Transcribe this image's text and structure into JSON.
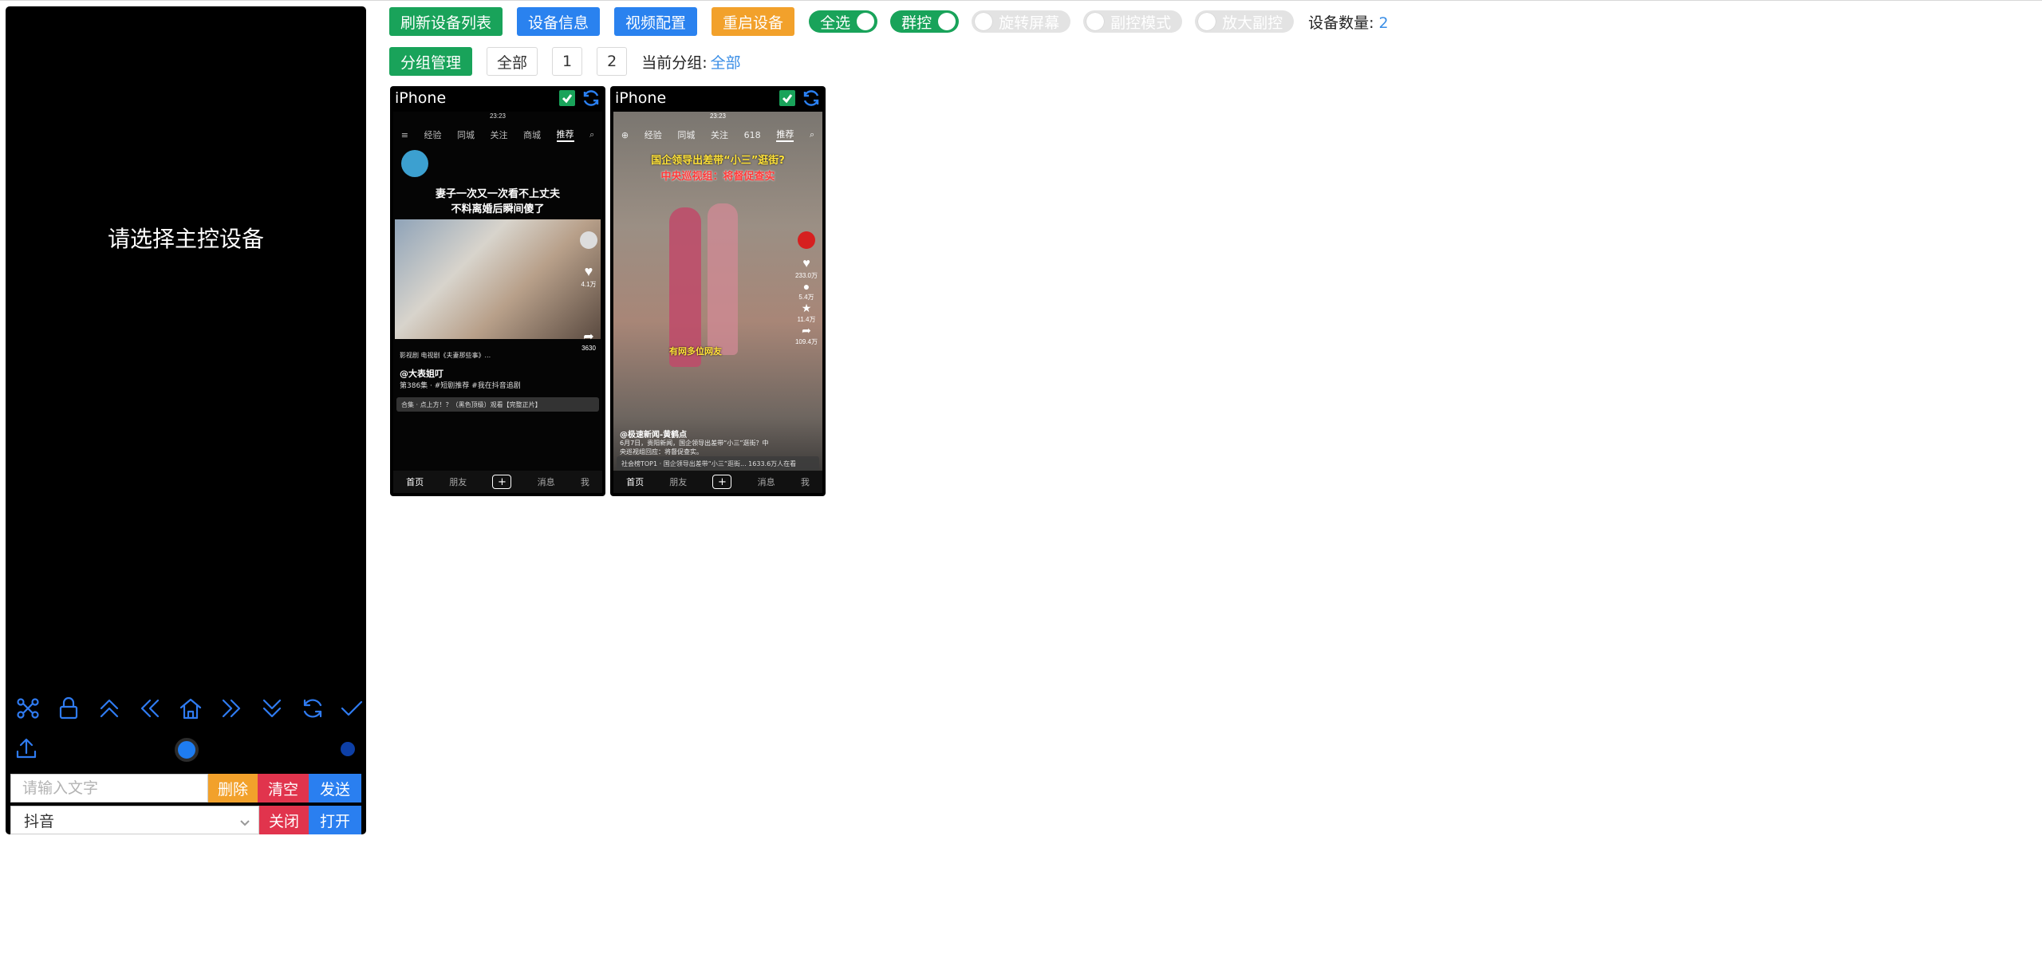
{
  "colors": {
    "accent_blue": "#2a82ef",
    "green": "#19a35a",
    "orange": "#f2a12b",
    "red": "#e1344d",
    "link_blue": "#3a8ee6"
  },
  "panel": {
    "message": "请选择主控设备",
    "icons": [
      "share-icon",
      "lock-icon",
      "double-chevron-up-icon",
      "double-chevron-left-icon",
      "home-icon",
      "double-chevron-right-icon",
      "double-chevron-down-icon",
      "refresh-icon",
      "check-icon"
    ],
    "upload_icon": "upload-icon",
    "text_input": {
      "placeholder": "请输入文字",
      "value": ""
    },
    "buttons": {
      "delete": "删除",
      "clear": "清空",
      "send": "发送",
      "close": "关闭",
      "open": "打开"
    },
    "app_select": {
      "value": "抖音"
    }
  },
  "toolbar": {
    "refresh_list": "刷新设备列表",
    "device_info": "设备信息",
    "video_config": "视频配置",
    "restart_device": "重启设备",
    "select_all": {
      "label": "全选",
      "on": true
    },
    "group_control": {
      "label": "群控",
      "on": true
    },
    "rotate_screen": {
      "label": "旋转屏幕",
      "on": false
    },
    "sub_control_mode": {
      "label": "副控模式",
      "on": false
    },
    "zoom_sub_control": {
      "label": "放大副控",
      "on": false
    },
    "device_count_label": "设备数量:",
    "device_count": "2"
  },
  "groups": {
    "manage": "分组管理",
    "items": [
      "全部",
      "1",
      "2"
    ],
    "current_label": "当前分组:",
    "current_value": "全部"
  },
  "devices": [
    {
      "name": "iPhone",
      "checked": true,
      "screen": {
        "time": "23:23",
        "tabs": [
          "经验",
          "同城",
          "关注",
          "商城",
          "推荐"
        ],
        "active_tab": "推荐",
        "caption_top": "妻子一次又一次看不上丈夫\n不料离婚后瞬间傻了",
        "author": "@大表姐叮",
        "desc": "第386集 · #短剧推荐 #我在抖音追剧",
        "link_text": "影视剧 电视剧《夫妻那些事》...",
        "promo": "合集 · 点上方！？（黑色顶级）观看【完整正片】",
        "side_counts": [
          "4.1万",
          "3630"
        ],
        "bottom": [
          "首页",
          "朋友",
          "+",
          "消息",
          "我"
        ]
      }
    },
    {
      "name": "iPhone",
      "checked": true,
      "screen": {
        "time": "23:23",
        "tabs": [
          "经验",
          "同城",
          "关注",
          "618",
          "推荐"
        ],
        "active_tab": "推荐",
        "headline_1": "国企领导出差带“小三”逛街?",
        "headline_2": "中央巡视组：将督促查实",
        "mid_caption": "有网多位网友",
        "author": "@极速新闻-黄鹤点",
        "desc": "6月7日，贵阳新闻，国企领导出差带“小三”逛街？中央巡视组回应：将督促查实。",
        "promo": "社会榜TOP1 · 国企领导出差带“小三”逛街... 1633.6万人在看",
        "side_counts": [
          "233.0万",
          "5.4万",
          "11.4万",
          "109.4万"
        ],
        "bottom": [
          "首页",
          "朋友",
          "+",
          "消息",
          "我"
        ]
      }
    }
  ]
}
